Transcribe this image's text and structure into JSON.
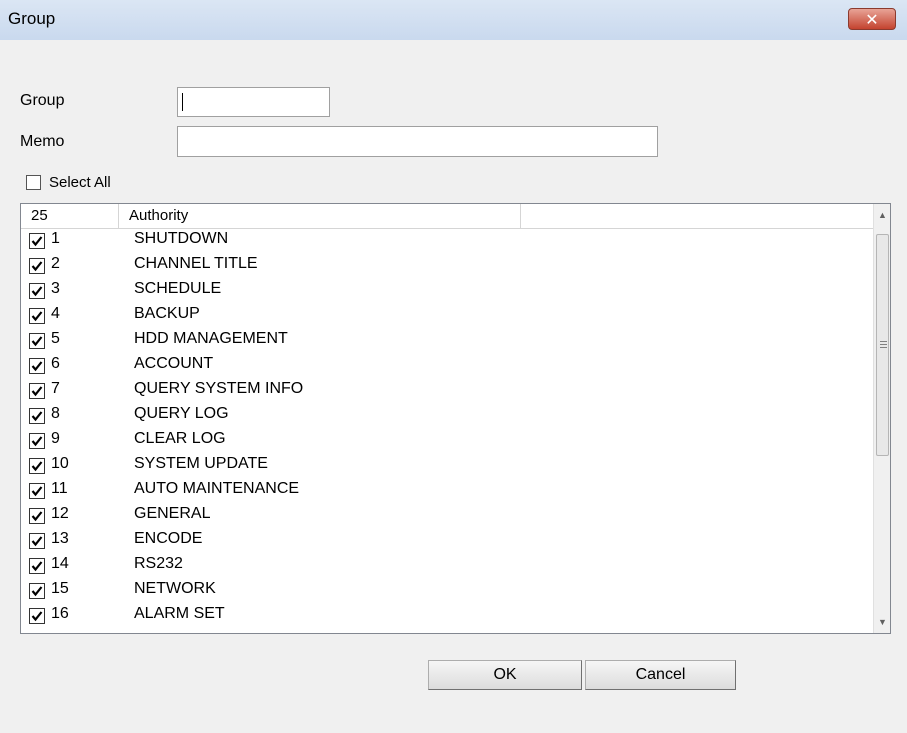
{
  "window": {
    "title": "Group",
    "close_glyph": "✕"
  },
  "form": {
    "group_label": "Group",
    "group_value": "",
    "memo_label": "Memo",
    "memo_value": "",
    "select_all_label": "Select All",
    "select_all_checked": false
  },
  "list": {
    "headers": [
      "25",
      "Authority",
      ""
    ],
    "rows": [
      {
        "num": "1",
        "label": "SHUTDOWN",
        "checked": true
      },
      {
        "num": "2",
        "label": "CHANNEL TITLE",
        "checked": true
      },
      {
        "num": "3",
        "label": "SCHEDULE",
        "checked": true
      },
      {
        "num": "4",
        "label": "BACKUP",
        "checked": true
      },
      {
        "num": "5",
        "label": "HDD MANAGEMENT",
        "checked": true
      },
      {
        "num": "6",
        "label": "ACCOUNT",
        "checked": true
      },
      {
        "num": "7",
        "label": "QUERY SYSTEM INFO",
        "checked": true
      },
      {
        "num": "8",
        "label": "QUERY LOG",
        "checked": true
      },
      {
        "num": "9",
        "label": "CLEAR LOG",
        "checked": true
      },
      {
        "num": "10",
        "label": "SYSTEM UPDATE",
        "checked": true
      },
      {
        "num": "11",
        "label": "AUTO MAINTENANCE",
        "checked": true
      },
      {
        "num": "12",
        "label": "GENERAL",
        "checked": true
      },
      {
        "num": "13",
        "label": "ENCODE",
        "checked": true
      },
      {
        "num": "14",
        "label": "RS232",
        "checked": true
      },
      {
        "num": "15",
        "label": "NETWORK",
        "checked": true
      },
      {
        "num": "16",
        "label": "ALARM SET",
        "checked": true
      }
    ]
  },
  "buttons": {
    "ok": "OK",
    "cancel": "Cancel"
  },
  "colors": {
    "title_gradient_top": "#dbe6f4",
    "close_button": "#c4432f",
    "dialog_bg": "#f0f0f0"
  },
  "icons": {
    "close": "close-icon",
    "check": "checkmark-icon",
    "scroll_up": "scroll-up-arrow-icon",
    "scroll_down": "scroll-down-arrow-icon"
  }
}
